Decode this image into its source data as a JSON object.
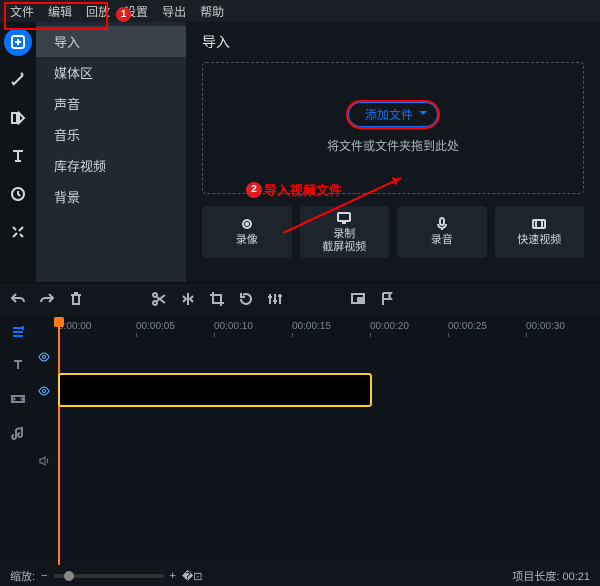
{
  "menu": {
    "file": "文件",
    "edit": "编辑",
    "playback": "回放",
    "settings": "设置",
    "export": "导出",
    "help": "帮助"
  },
  "side": {
    "items": [
      "导入",
      "媒体区",
      "声音",
      "音乐",
      "库存视频",
      "背景"
    ],
    "selectedIndex": 0
  },
  "annotations": {
    "badge1": "1",
    "badge2": "2",
    "text2": "导入视频文件"
  },
  "main": {
    "title": "导入",
    "addFiles": "添加文件",
    "dropHint": "将文件或文件夹拖到此处",
    "cards": [
      {
        "key": "record",
        "label": "录像"
      },
      {
        "key": "screencap",
        "label": "录制\n截屏视频"
      },
      {
        "key": "audio",
        "label": "录音"
      },
      {
        "key": "quick",
        "label": "快速视频"
      }
    ]
  },
  "ruler": {
    "ticks": [
      "0:00:00",
      "00:00:05",
      "00:00:10",
      "00:00:15",
      "00:00:20",
      "00:00:25",
      "00:00:30"
    ]
  },
  "footer": {
    "zoomLabel": "缩放:",
    "lengthLabel": "项目长度:",
    "lengthValue": "00:21"
  }
}
